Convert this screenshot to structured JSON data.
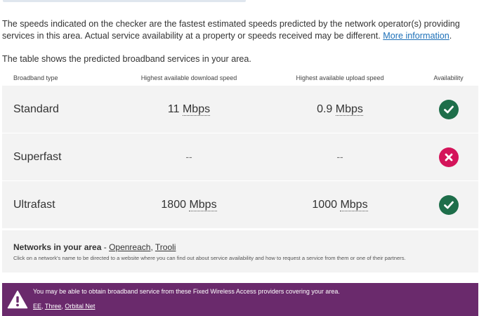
{
  "intro": {
    "text": "The speeds indicated on the checker are the fastest estimated speeds predicted by the network operator(s) providing services in this area. Actual service availability at a property or speeds received may be different.",
    "link_label": "More information",
    "after_link": "."
  },
  "lead": "The table shows the predicted broadband services in your area.",
  "table": {
    "headers": {
      "type": "Broadband type",
      "download": "Highest available download speed",
      "upload": "Highest available upload speed",
      "availability": "Availability"
    },
    "rows": [
      {
        "type": "Standard",
        "download_value": "11",
        "download_unit": "Mbps",
        "upload_value": "0.9",
        "upload_unit": "Mbps",
        "available": "yes"
      },
      {
        "type": "Superfast",
        "download_value": "--",
        "download_unit": "",
        "upload_value": "--",
        "upload_unit": "",
        "available": "no"
      },
      {
        "type": "Ultrafast",
        "download_value": "1800",
        "download_unit": "Mbps",
        "upload_value": "1000",
        "upload_unit": "Mbps",
        "available": "yes"
      }
    ]
  },
  "networks": {
    "title": "Networks in your area",
    "separator": " - ",
    "links": [
      "Openreach",
      "Trooli"
    ],
    "note": "Click on a network's name to be directed to a website where you can find out about service availability and how to request a service from them or one of their partners."
  },
  "fwa": {
    "message": "You may be able to obtain broadband service from these Fixed Wireless Access providers covering your area.",
    "providers": [
      "EE",
      "Three",
      "Orbital Net"
    ]
  },
  "colors": {
    "available": "#1e6e4a",
    "unavailable": "#d4145a",
    "banner": "#6a2a6c",
    "link": "#1d70b8"
  },
  "icons": {
    "available": "check-circle-icon",
    "unavailable": "cross-circle-icon",
    "warning": "warning-triangle-icon"
  }
}
